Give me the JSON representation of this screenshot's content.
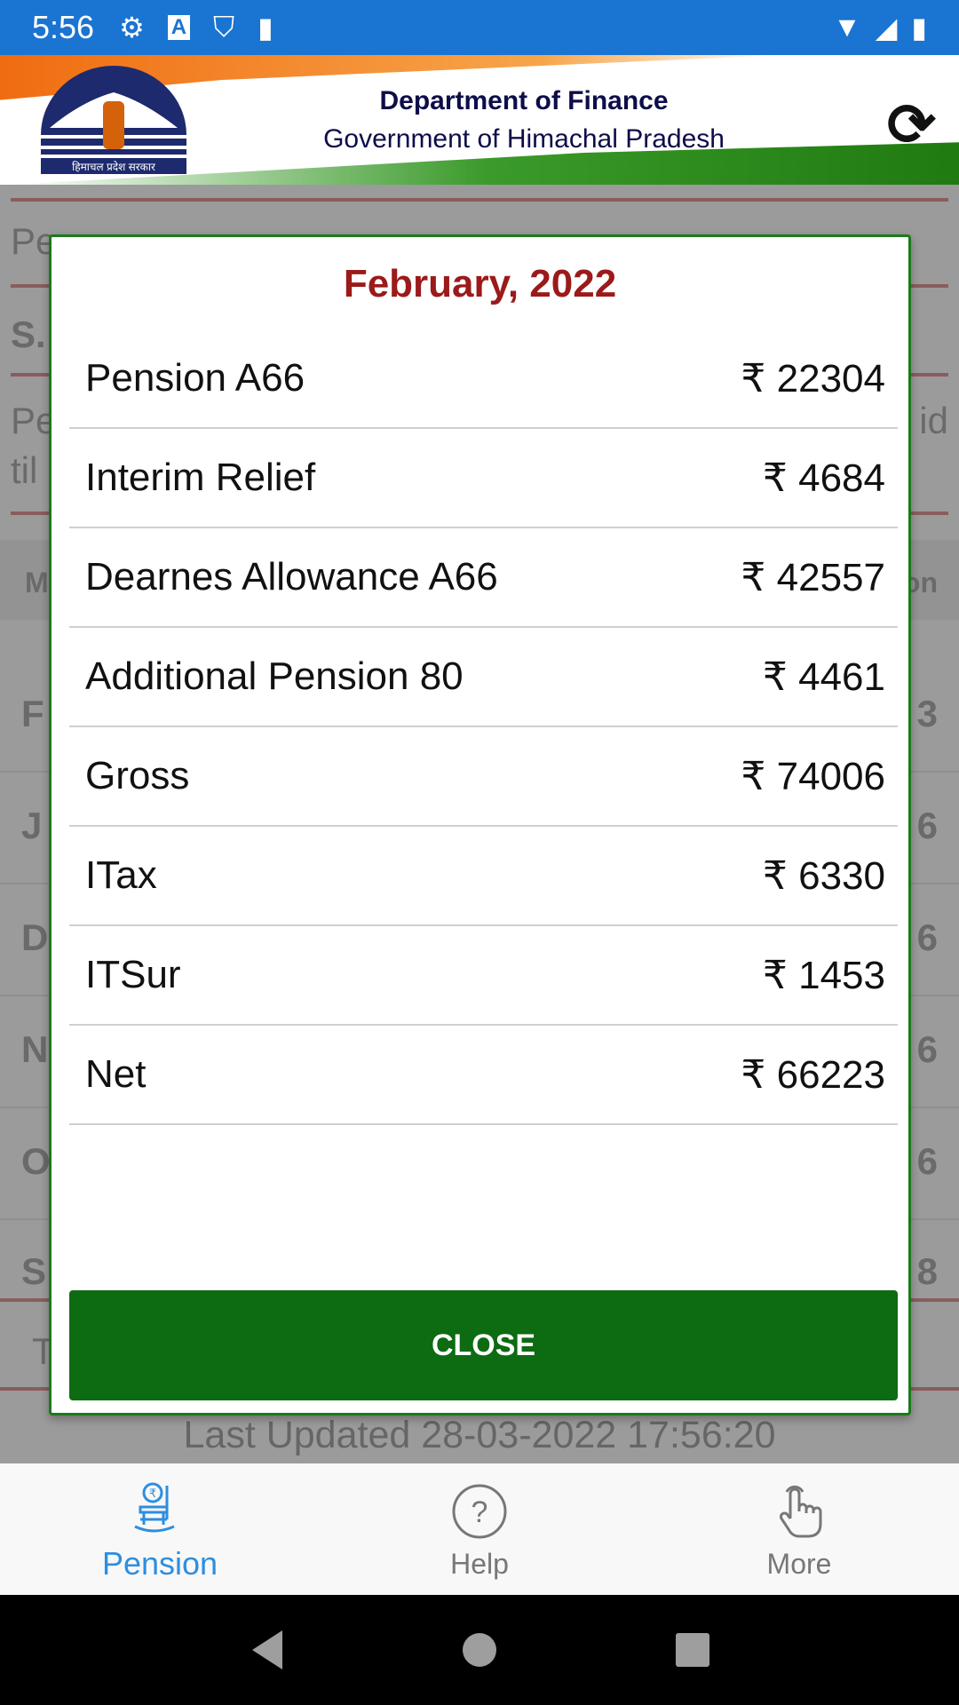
{
  "status_bar": {
    "time": "5:56",
    "icons": [
      "gear-icon",
      "a-icon",
      "play-shield-icon",
      "sd-card-icon",
      "wifi-icon",
      "signal-icon",
      "battery-icon"
    ]
  },
  "header": {
    "title": "Department of Finance",
    "subtitle": "Government of Himachal Pradesh",
    "logo_text": "हिमाचल प्रदेश सरकार",
    "refresh_icon": "refresh-icon"
  },
  "background": {
    "fragments": [
      "Pe",
      "S.",
      "Pe",
      "til",
      "id",
      "M",
      "on",
      "F",
      "J",
      "D",
      "N",
      "O",
      "S",
      "T",
      "3",
      "6",
      "6",
      "6",
      "6",
      "8"
    ],
    "last_updated": "Last Updated 28-03-2022 17:56:20"
  },
  "dialog": {
    "title": "February, 2022",
    "rows": [
      {
        "label": "Pension A66",
        "value": "₹ 22304"
      },
      {
        "label": "Interim Relief",
        "value": "₹ 4684"
      },
      {
        "label": "Dearnes Allowance A66",
        "value": "₹ 42557"
      },
      {
        "label": "Additional Pension 80",
        "value": "₹ 4461"
      },
      {
        "label": "Gross",
        "value": "₹ 74006"
      },
      {
        "label": "ITax",
        "value": "₹ 6330"
      },
      {
        "label": "ITSur",
        "value": "₹ 1453"
      },
      {
        "label": "Net",
        "value": "₹ 66223"
      }
    ],
    "close_label": "CLOSE",
    "accent": "#0d6b11",
    "title_color": "#9b1a1a"
  },
  "bottom_nav": {
    "items": [
      {
        "label": "Pension",
        "active": true
      },
      {
        "label": "Help",
        "active": false
      },
      {
        "label": "More",
        "active": false
      }
    ],
    "active_color": "#2d8ee0"
  }
}
